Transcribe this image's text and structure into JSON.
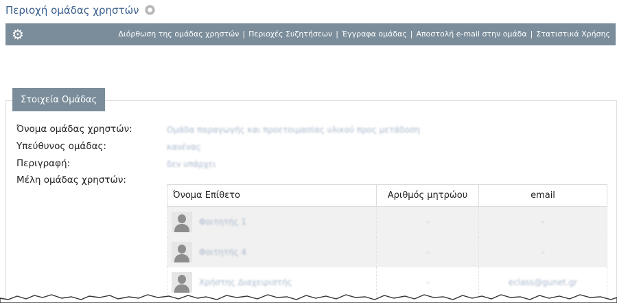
{
  "page": {
    "title": "Περιοχή ομάδας χρηστών"
  },
  "toolbar": {
    "links": [
      "Διόρθωση της ομάδας χρηστών",
      "Περιοχές Συζητήσεων",
      "Έγγραφα ομάδας",
      "Αποστολή e-mail στην ομάδα",
      "Στατιστικά Χρήσης"
    ]
  },
  "group_info": {
    "legend": "Στοιχεία Ομάδας",
    "name_label": "Όνομα ομάδας χρηστών:",
    "name_value": "Ομάδα παραγωγής και προετοιμασίας υλικού προς μετάδοση",
    "manager_label": "Υπεύθυνος ομάδας:",
    "manager_value": "κανένας",
    "description_label": "Περιγραφή:",
    "description_value": "δεν υπάρχει",
    "members_label": "Μέλη ομάδας χρηστών:"
  },
  "members_table": {
    "headers": [
      "Όνομα Επίθετο",
      "Αριθμός μητρώου",
      "email"
    ],
    "rows": [
      {
        "name": "Φοιτητής 1",
        "id": "-",
        "email": "-"
      },
      {
        "name": "Φοιτητής 4",
        "id": "-",
        "email": "-"
      },
      {
        "name": "Χρήστης Διαχειριστής",
        "id": "-",
        "email": "eclass@gunet.gr"
      }
    ]
  }
}
